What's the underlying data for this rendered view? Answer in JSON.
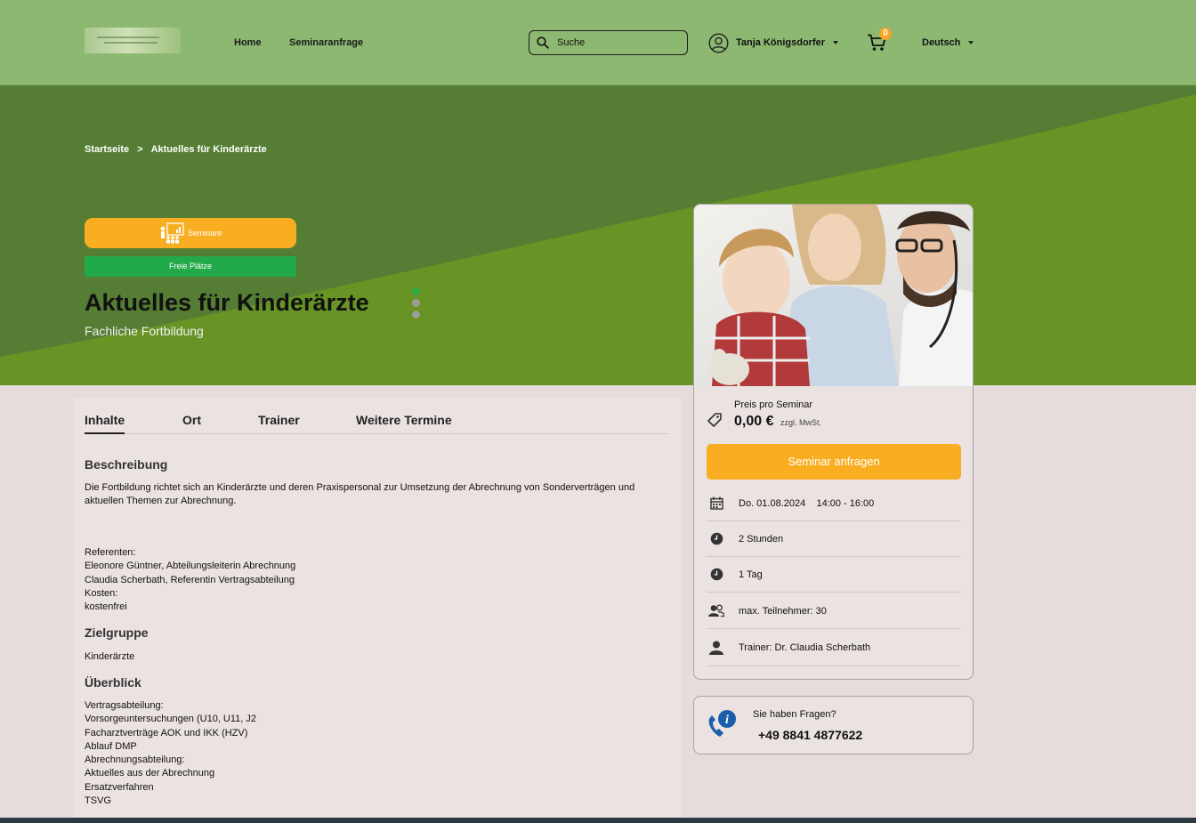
{
  "header": {
    "nav": [
      "Home",
      "Seminaranfrage"
    ],
    "search_placeholder": "Suche",
    "user_name": "Tanja Königsdorfer",
    "cart_count": "0",
    "language": "Deutsch"
  },
  "hero": {
    "breadcrumb": [
      "Startseite",
      ">",
      "Aktuelles für Kinderärzte"
    ],
    "category_button": "Seminare",
    "availability_badge": "Freie Plätze",
    "title": "Aktuelles für Kinderärzte",
    "subtitle": "Fachliche Fortbildung"
  },
  "tabs": [
    "Inhalte",
    "Ort",
    "Trainer",
    "Weitere Termine"
  ],
  "content": {
    "desc_heading": "Beschreibung",
    "desc_text": "Die Fortbildung richtet sich an Kinderärzte und deren Praxispersonal zur Umsetzung der Abrechnung von Sonderverträgen und aktuellen Themen zur Abrechnung.",
    "desc_lines": [
      "Referenten:",
      "Eleonore Güntner, Abteilungsleiterin Abrechnung",
      "Claudia Scherbath, Referentin Vertragsabteilung",
      "Kosten:",
      "kostenfrei"
    ],
    "audience_heading": "Zielgruppe",
    "audience_text": "Kinderärzte",
    "overview_heading": "Überblick",
    "overview_lines": [
      "Vertragsabteilung:",
      "Vorsorgeuntersuchungen (U10, U11, J2",
      "Facharztverträge AOK und IKK (HZV)",
      "Ablauf DMP",
      "Abrechnungsabteilung:",
      "Aktuelles aus der Abrechnung",
      "Ersatzverfahren",
      "TSVG"
    ]
  },
  "card": {
    "price_label": "Preis pro Seminar",
    "price": "0,00 €",
    "price_note": "zzgl. MwSt.",
    "request_button": "Seminar anfragen",
    "rows": [
      {
        "icon": "calendar-icon",
        "text": "Do. 01.08.2024    14:00 - 16:00"
      },
      {
        "icon": "clock-icon",
        "text": "2 Stunden"
      },
      {
        "icon": "clock-icon",
        "text": "1 Tag"
      },
      {
        "icon": "users-icon",
        "text": "max. Teilnehmer: 30"
      },
      {
        "icon": "person-icon",
        "text": "Trainer: Dr. Claudia Scherbath"
      }
    ]
  },
  "help": {
    "question": "Sie haben Fragen?",
    "phone": "+49 8841 4877622"
  },
  "colors": {
    "header_bg": "#8db872",
    "hero_dark": "#5a8234",
    "hero_light": "#6a9a28",
    "accent_orange": "#f9ae22",
    "badge_green": "#22a94a",
    "phone_icon_blue": "#1a5ea8"
  }
}
